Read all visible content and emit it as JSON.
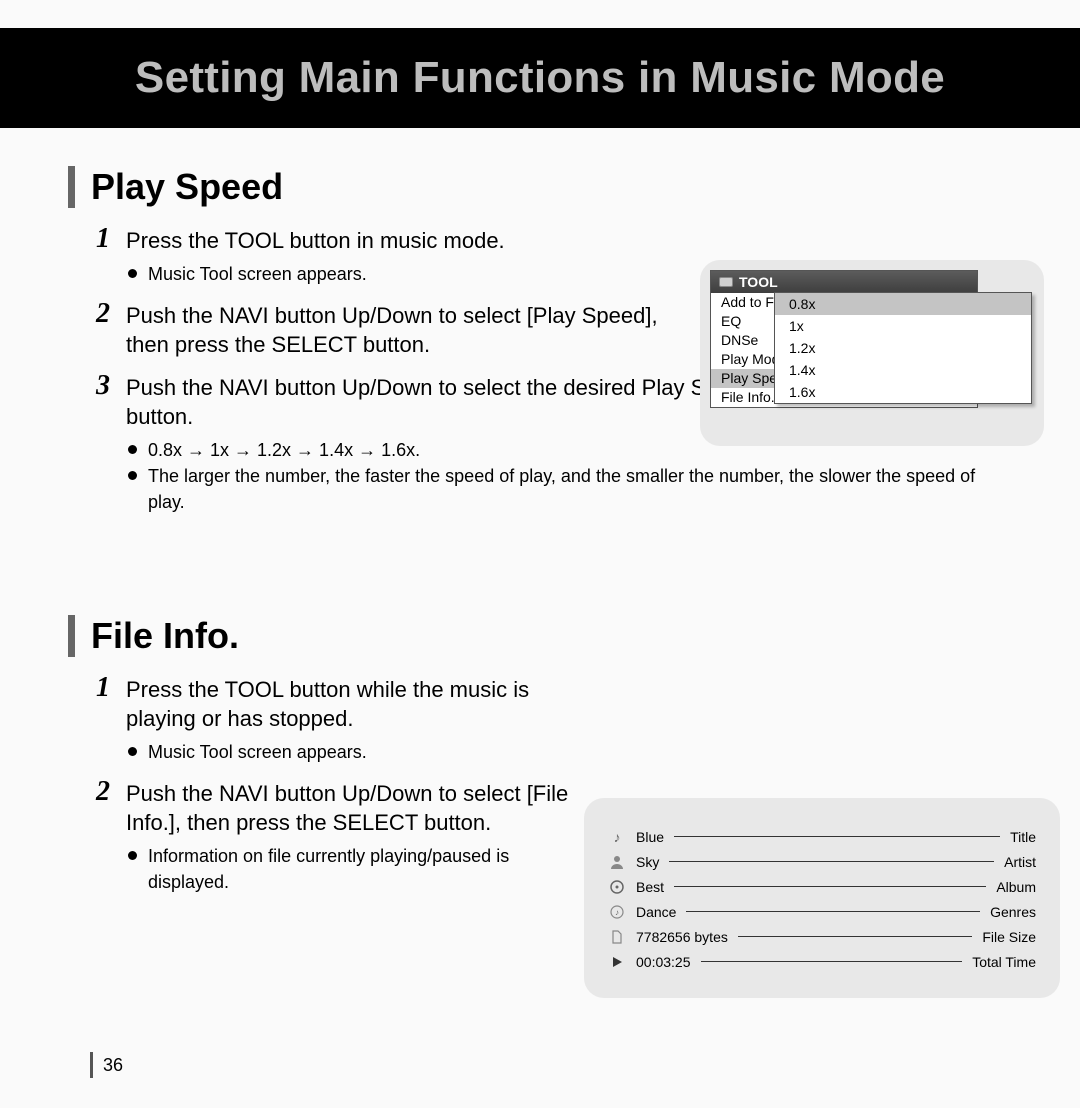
{
  "title": "Setting Main Functions in Music Mode",
  "page_number": "36",
  "section1": {
    "heading": "Play Speed",
    "steps": [
      {
        "num": "1",
        "text": "Press the TOOL button in music mode.",
        "bullets": [
          "Music Tool screen appears."
        ]
      },
      {
        "num": "2",
        "text": "Push the NAVI button Up/Down to select [Play Speed], then press the SELECT button."
      },
      {
        "num": "3",
        "text": "Push the NAVI button Up/Down to select the desired Play Speed, then press the SELECT button.",
        "bullets": [
          "0.8x → 1x → 1.2x → 1.4x → 1.6x.",
          "The larger the number, the faster the speed of play, and the smaller the number, the slower the speed of play."
        ]
      }
    ]
  },
  "section2": {
    "heading": "File Info.",
    "steps": [
      {
        "num": "1",
        "text": "Press the TOOL button while the music is playing or has stopped.",
        "bullets": [
          "Music Tool screen appears."
        ]
      },
      {
        "num": "2",
        "text": "Push the NAVI button Up/Down to select [File Info.], then press the SELECT button.",
        "bullets": [
          "Information on file currently playing/paused is displayed."
        ]
      }
    ]
  },
  "fig1": {
    "header": "TOOL",
    "items": [
      "Add to Favorites",
      "EQ",
      "DNSe",
      "Play Mode",
      "Play Speed",
      "File Info."
    ],
    "selected_item_index": 4,
    "speed_options": [
      "0.8x",
      "1x",
      "1.2x",
      "1.4x",
      "1.6x"
    ],
    "selected_speed_index": 0
  },
  "fig2": {
    "rows": [
      {
        "icon": "note-icon",
        "value": "Blue",
        "label": "Title"
      },
      {
        "icon": "person-icon",
        "value": "Sky",
        "label": "Artist"
      },
      {
        "icon": "disc-icon",
        "value": "Best",
        "label": "Album"
      },
      {
        "icon": "genre-icon",
        "value": "Dance",
        "label": "Genres"
      },
      {
        "icon": "file-icon",
        "value": "7782656 bytes",
        "label": "File Size"
      },
      {
        "icon": "play-icon",
        "value": "00:03:25",
        "label": "Total Time"
      }
    ]
  }
}
